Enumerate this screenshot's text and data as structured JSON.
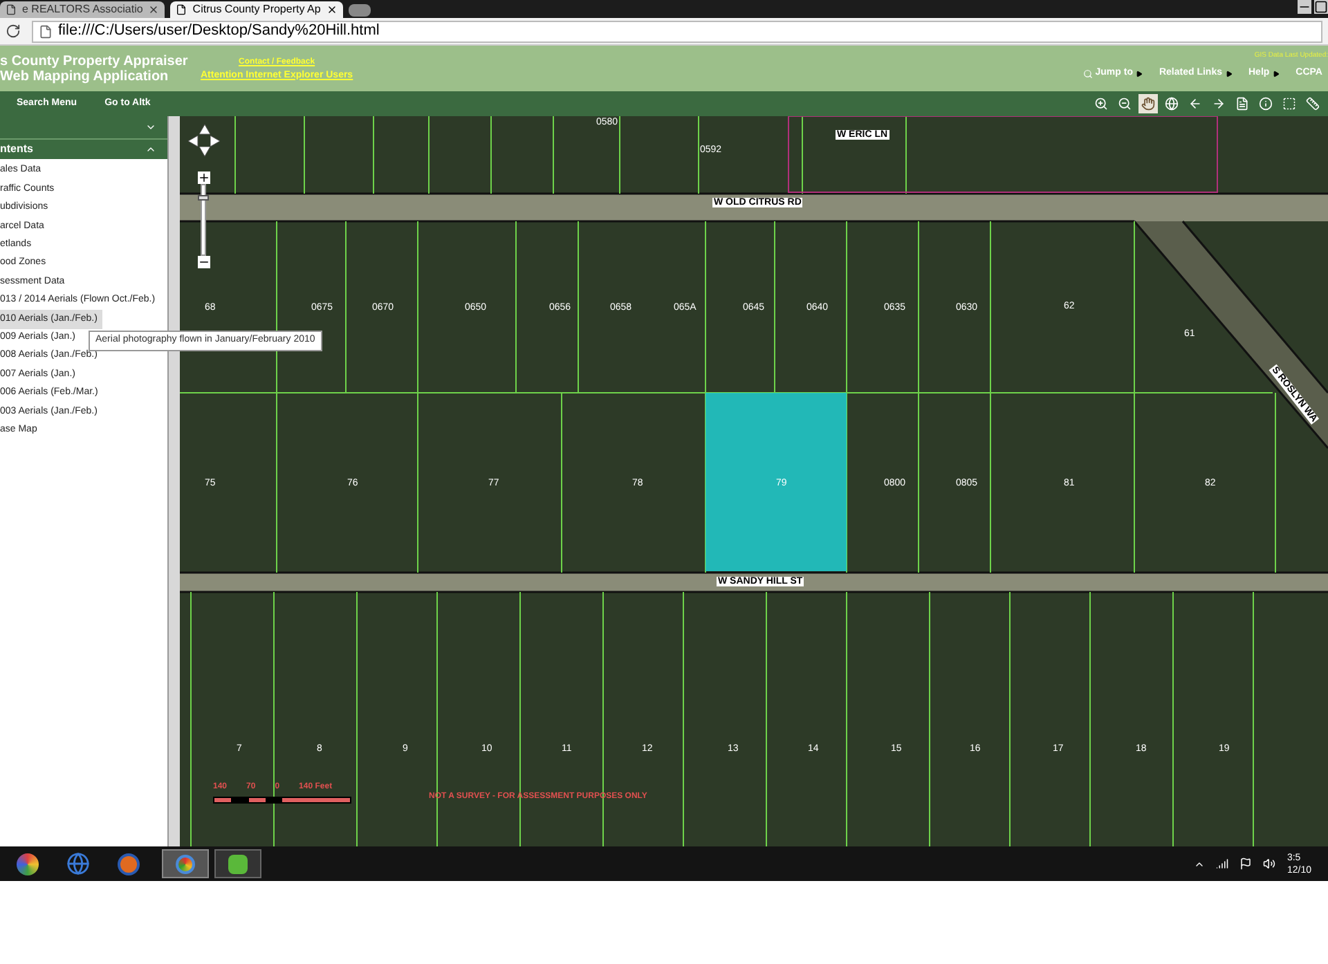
{
  "browser": {
    "tabs": [
      {
        "label": "e REALTORS Associatio",
        "selected": false
      },
      {
        "label": "Citrus County Property Ap",
        "selected": true
      }
    ],
    "url": "file:///C:/Users/user/Desktop/Sandy%20Hill.html"
  },
  "header": {
    "title_lines": [
      "s County Property Appraiser",
      "Web Mapping Application"
    ],
    "links": [
      "Contact / Feedback",
      "Attention Internet Explorer Users"
    ],
    "gis_note": "GIS Data Last Updated:",
    "nav": [
      "Jump to",
      "Related Links",
      "Help",
      "CCPA"
    ]
  },
  "toolbar": {
    "menus": [
      "Search Menu",
      "Go to Altk"
    ],
    "tools": [
      {
        "kind": "zoom_in",
        "selected": false
      },
      {
        "kind": "zoom_out",
        "selected": false
      },
      {
        "kind": "pan",
        "selected": true
      },
      {
        "kind": "globe",
        "selected": false
      },
      {
        "kind": "back",
        "selected": false
      },
      {
        "kind": "forward",
        "selected": false
      },
      {
        "kind": "document",
        "selected": false
      },
      {
        "kind": "info",
        "selected": false
      },
      {
        "kind": "select",
        "selected": false
      },
      {
        "kind": "measure",
        "selected": false
      }
    ]
  },
  "sidebar": {
    "heading": "ntents",
    "items": [
      {
        "label": "ales Data",
        "selected": false
      },
      {
        "label": "raffic Counts",
        "selected": false
      },
      {
        "label": "ubdivisions",
        "selected": false
      },
      {
        "label": "arcel Data",
        "selected": false
      },
      {
        "label": "etlands",
        "selected": false
      },
      {
        "label": "ood Zones",
        "selected": false
      },
      {
        "label": "sessment Data",
        "selected": false
      },
      {
        "label": "013 / 2014 Aerials (Flown Oct./Feb.)",
        "selected": false
      },
      {
        "label": "010 Aerials (Jan./Feb.)",
        "selected": true
      },
      {
        "label": "009 Aerials (Jan.)",
        "selected": false
      },
      {
        "label": "008 Aerials (Jan./Feb.)",
        "selected": false
      },
      {
        "label": "007 Aerials (Jan.)",
        "selected": false
      },
      {
        "label": "006 Aerials (Feb./Mar.)",
        "selected": false
      },
      {
        "label": "003 Aerials (Jan./Feb.)",
        "selected": false
      },
      {
        "label": "ase Map",
        "selected": false
      }
    ],
    "tooltip": "Aerial photography flown in January/February 2010"
  },
  "map": {
    "zoom": {
      "level": 0.85
    },
    "streets": [
      "W ERIC LN",
      "W OLD CITRUS RD",
      "W SANDY HILL ST",
      "S ROSLYN WA"
    ],
    "parcels_north": [
      "0580",
      "0592"
    ],
    "parcels_row_1": [
      "68",
      "0675",
      "0670",
      "0650",
      "0656",
      "0658",
      "065A",
      "0645",
      "0640",
      "0635",
      "0630",
      "62",
      "61"
    ],
    "parcels_row_2": [
      "75",
      "76",
      "77",
      "78",
      "79",
      "0800",
      "0805",
      "81",
      "82"
    ],
    "parcels_row_3": [
      "7",
      "8",
      "9",
      "10",
      "11",
      "12",
      "13",
      "14",
      "15",
      "16",
      "17",
      "18",
      "19"
    ],
    "scale": [
      "140",
      "70",
      "0",
      "140 Feet"
    ],
    "disclaimer": "NOT A SURVEY - FOR ASSESSMENT PURPOSES ONLY"
  },
  "taskbar": {
    "time": "3:5",
    "date": "12/10"
  }
}
